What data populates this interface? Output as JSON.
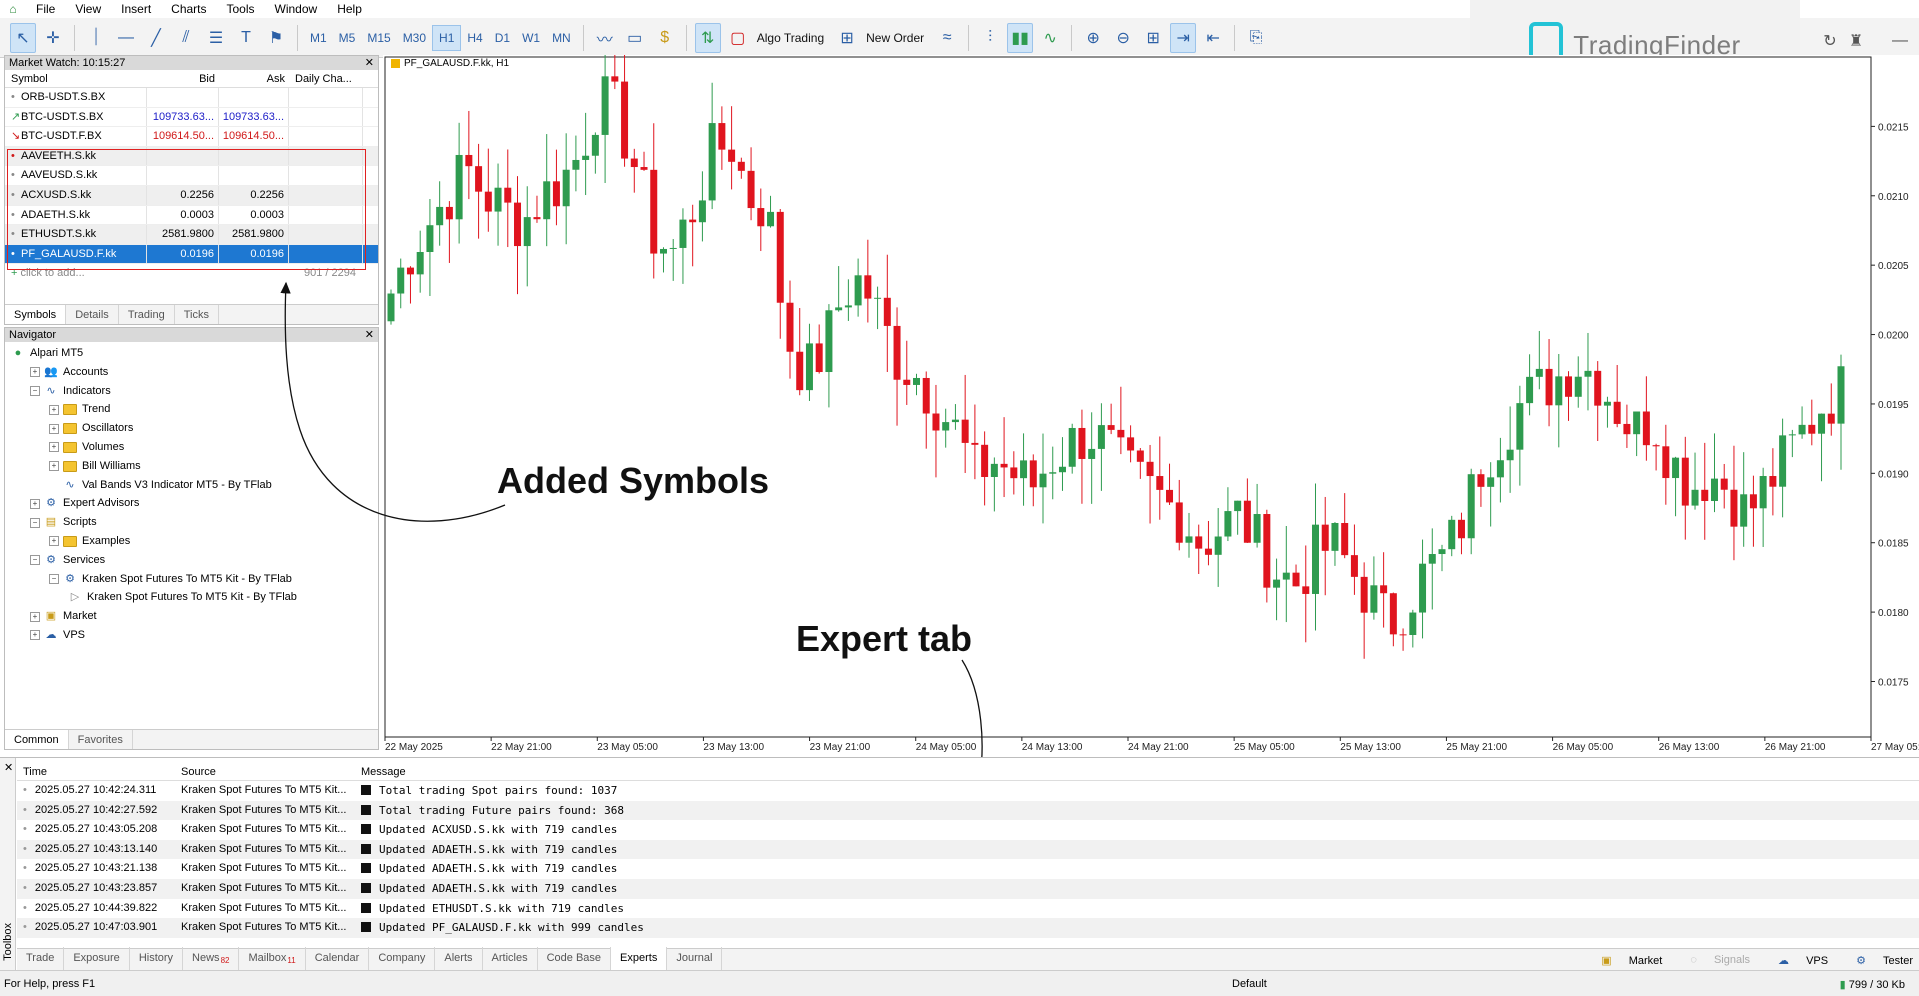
{
  "menubar": {
    "items": [
      "File",
      "View",
      "Insert",
      "Charts",
      "Tools",
      "Window",
      "Help"
    ]
  },
  "toolbar": {
    "timeframes": [
      "M1",
      "M5",
      "M15",
      "M30",
      "H1",
      "H4",
      "D1",
      "W1",
      "MN"
    ],
    "active_timeframe": "H1",
    "algo_trading_label": "Algo Trading",
    "new_order_label": "New Order"
  },
  "logo": {
    "text": "TradingFinder"
  },
  "market_watch": {
    "title": "Market Watch: 10:15:27",
    "columns": [
      "Symbol",
      "Bid",
      "Ask",
      "Daily Cha..."
    ],
    "rows": [
      {
        "symbol": "ORB-USDT.S.BX",
        "bid": "",
        "ask": "",
        "change": ""
      },
      {
        "symbol": "BTC-USDT.S.BX",
        "bid": "109733.63...",
        "ask": "109733.63...",
        "change": ""
      },
      {
        "symbol": "BTC-USDT.F.BX",
        "bid": "109614.50...",
        "ask": "109614.50...",
        "change": ""
      },
      {
        "symbol": "AAVEETH.S.kk",
        "bid": "",
        "ask": "",
        "change": ""
      },
      {
        "symbol": "AAVEUSD.S.kk",
        "bid": "",
        "ask": "",
        "change": ""
      },
      {
        "symbol": "ACXUSD.S.kk",
        "bid": "0.2256",
        "ask": "0.2256",
        "change": ""
      },
      {
        "symbol": "ADAETH.S.kk",
        "bid": "0.0003",
        "ask": "0.0003",
        "change": ""
      },
      {
        "symbol": "ETHUSDT.S.kk",
        "bid": "2581.9800",
        "ask": "2581.9800",
        "change": ""
      },
      {
        "symbol": "PF_GALAUSD.F.kk",
        "bid": "0.0196",
        "ask": "0.0196",
        "change": ""
      }
    ],
    "add_placeholder": "click to add...",
    "count": "901 / 2294",
    "tabs": [
      "Symbols",
      "Details",
      "Trading",
      "Ticks"
    ]
  },
  "navigator": {
    "title": "Navigator",
    "items": [
      {
        "label": "Alpari MT5",
        "level": 0,
        "icon": "broker-icon"
      },
      {
        "label": "Accounts",
        "level": 1,
        "icon": "accounts-icon"
      },
      {
        "label": "Indicators",
        "level": 1,
        "icon": "indicators-icon"
      },
      {
        "label": "Trend",
        "level": 2,
        "icon": "folder-icon"
      },
      {
        "label": "Oscillators",
        "level": 2,
        "icon": "folder-icon"
      },
      {
        "label": "Volumes",
        "level": 2,
        "icon": "folder-icon"
      },
      {
        "label": "Bill Williams",
        "level": 2,
        "icon": "folder-icon"
      },
      {
        "label": "Val Bands V3 Indicator MT5 - By TFlab",
        "level": 2,
        "icon": "indicator-icon"
      },
      {
        "label": "Expert Advisors",
        "level": 1,
        "icon": "experts-icon"
      },
      {
        "label": "Scripts",
        "level": 1,
        "icon": "scripts-icon"
      },
      {
        "label": "Examples",
        "level": 2,
        "icon": "folder-icon"
      },
      {
        "label": "Services",
        "level": 1,
        "icon": "services-icon"
      },
      {
        "label": "Kraken Spot Futures To MT5 Kit - By TFlab",
        "level": 2,
        "icon": "service-icon"
      },
      {
        "label": "Kraken Spot Futures To MT5 Kit - By TFlab",
        "level": 3,
        "icon": "play-icon"
      },
      {
        "label": "Market",
        "level": 1,
        "icon": "market-icon"
      },
      {
        "label": "VPS",
        "level": 1,
        "icon": "vps-icon"
      }
    ],
    "tabs": [
      "Common",
      "Favorites"
    ]
  },
  "chart": {
    "label": "PF_GALAUSD.F.kk, H1",
    "price_ticks": [
      "0.0215",
      "0.0210",
      "0.0205",
      "0.0200",
      "0.0195",
      "0.0190",
      "0.0185",
      "0.0180",
      "0.0175"
    ],
    "time_ticks": [
      "22 May 2025",
      "22 May 21:00",
      "23 May 05:00",
      "23 May 13:00",
      "23 May 21:00",
      "24 May 05:00",
      "24 May 13:00",
      "24 May 21:00",
      "25 May 05:00",
      "25 May 13:00",
      "25 May 21:00",
      "26 May 05:00",
      "26 May 13:00",
      "26 May 21:00",
      "27 May 05:00"
    ],
    "up_color": "#2e9b4f",
    "down_color": "#e0141e"
  },
  "chart_data": {
    "type": "candlestick",
    "symbol": "PF_GALAUSD.F.kk",
    "timeframe": "H1",
    "ylim": [
      0.0171,
      0.022
    ],
    "close_path": [
      0.0203,
      0.0206,
      0.0208,
      0.021,
      0.0212,
      0.021,
      0.0209,
      0.0208,
      0.021,
      0.0211,
      0.0213,
      0.0217,
      0.0216,
      0.0212,
      0.0207,
      0.0206,
      0.0209,
      0.0213,
      0.0214,
      0.021,
      0.0209,
      0.02,
      0.0197,
      0.0199,
      0.0203,
      0.0204,
      0.0201,
      0.0198,
      0.0197,
      0.0195,
      0.0193,
      0.019,
      0.0191,
      0.019,
      0.0189,
      0.0191,
      0.0192,
      0.0193,
      0.0192,
      0.019,
      0.0189,
      0.0188,
      0.0187,
      0.0185,
      0.0186,
      0.0187,
      0.0185,
      0.0183,
      0.0182,
      0.0184,
      0.0185,
      0.0183,
      0.0181,
      0.0179,
      0.0181,
      0.0183,
      0.0184,
      0.0187,
      0.0191,
      0.0193,
      0.0195,
      0.0196,
      0.0197,
      0.0198,
      0.0197,
      0.0195,
      0.0193,
      0.0194,
      0.0191,
      0.0189,
      0.019,
      0.0189,
      0.0187,
      0.0189,
      0.0191,
      0.0193,
      0.0195,
      0.0196
    ]
  },
  "annotations": {
    "added_symbols": "Added Symbols",
    "expert_tab": "Expert tab"
  },
  "toolbox": {
    "side_label": "Toolbox",
    "columns": [
      "Time",
      "Source",
      "Message"
    ],
    "rows": [
      {
        "time": "2025.05.27 10:42:24.311",
        "source": "Kraken Spot Futures To MT5 Kit...",
        "message": "Total trading Spot pairs found: 1037"
      },
      {
        "time": "2025.05.27 10:42:27.592",
        "source": "Kraken Spot Futures To MT5 Kit...",
        "message": "Total trading Future pairs found: 368"
      },
      {
        "time": "2025.05.27 10:43:05.208",
        "source": "Kraken Spot Futures To MT5 Kit...",
        "message": "Updated ACXUSD.S.kk with 719 candles"
      },
      {
        "time": "2025.05.27 10:43:13.140",
        "source": "Kraken Spot Futures To MT5 Kit...",
        "message": "Updated ADAETH.S.kk with 719 candles"
      },
      {
        "time": "2025.05.27 10:43:21.138",
        "source": "Kraken Spot Futures To MT5 Kit...",
        "message": "Updated ADAETH.S.kk with 719 candles"
      },
      {
        "time": "2025.05.27 10:43:23.857",
        "source": "Kraken Spot Futures To MT5 Kit...",
        "message": "Updated ADAETH.S.kk with 719 candles"
      },
      {
        "time": "2025.05.27 10:44:39.822",
        "source": "Kraken Spot Futures To MT5 Kit...",
        "message": "Updated ETHUSDT.S.kk with 719 candles"
      },
      {
        "time": "2025.05.27 10:47:03.901",
        "source": "Kraken Spot Futures To MT5 Kit...",
        "message": "Updated PF_GALAUSD.F.kk with 999 candles"
      }
    ],
    "tabs": [
      {
        "label": "Trade",
        "badge": ""
      },
      {
        "label": "Exposure",
        "badge": ""
      },
      {
        "label": "History",
        "badge": ""
      },
      {
        "label": "News",
        "badge": "82"
      },
      {
        "label": "Mailbox",
        "badge": "11"
      },
      {
        "label": "Calendar",
        "badge": ""
      },
      {
        "label": "Company",
        "badge": ""
      },
      {
        "label": "Alerts",
        "badge": ""
      },
      {
        "label": "Articles",
        "badge": ""
      },
      {
        "label": "Code Base",
        "badge": ""
      },
      {
        "label": "Experts",
        "badge": ""
      },
      {
        "label": "Journal",
        "badge": ""
      }
    ],
    "active_tab": "Experts",
    "right": {
      "market": "Market",
      "signals": "Signals",
      "vps": "VPS",
      "tester": "Tester"
    }
  },
  "statusbar": {
    "help": "For Help, press F1",
    "profile": "Default",
    "traffic": "799 / 30 Kb"
  }
}
